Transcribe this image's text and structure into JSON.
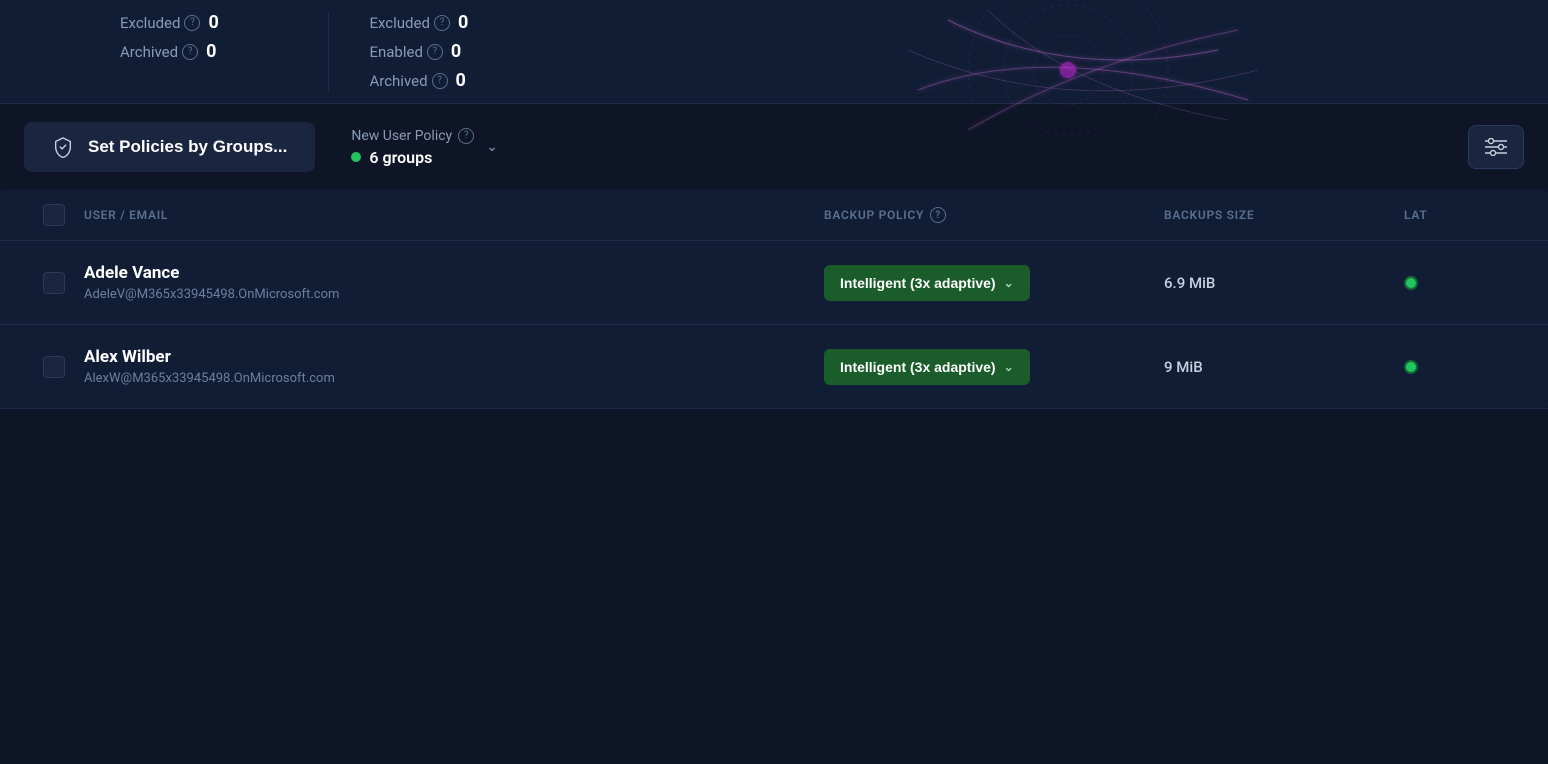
{
  "stats_top": {
    "col1": [
      {
        "label": "Excluded",
        "value": "0"
      },
      {
        "label": "Archived",
        "value": "0"
      }
    ],
    "col2": [
      {
        "label": "Excluded",
        "value": "0"
      },
      {
        "label": "Enabled",
        "value": "0"
      },
      {
        "label": "Archived",
        "value": "0"
      }
    ]
  },
  "policy_bar": {
    "set_policies_btn_label": "Set Policies by Groups...",
    "new_user_policy_label": "New User Policy",
    "groups_label": "6 groups",
    "filter_icon_label": "≡"
  },
  "table": {
    "headers": {
      "user_email": "USER / EMAIL",
      "backup_policy": "BACKUP POLICY",
      "backups_size": "BACKUPS SIZE",
      "latest": "LAT"
    },
    "rows": [
      {
        "name": "Adele Vance",
        "email": "AdeleV@M365x33945498.OnMicrosoft.com",
        "policy": "Intelligent (3x adaptive)",
        "size": "6.9 MiB",
        "status": "active"
      },
      {
        "name": "Alex Wilber",
        "email": "AlexW@M365x33945498.OnMicrosoft.com",
        "policy": "Intelligent (3x adaptive)",
        "size": "9 MiB",
        "status": "active"
      }
    ]
  }
}
